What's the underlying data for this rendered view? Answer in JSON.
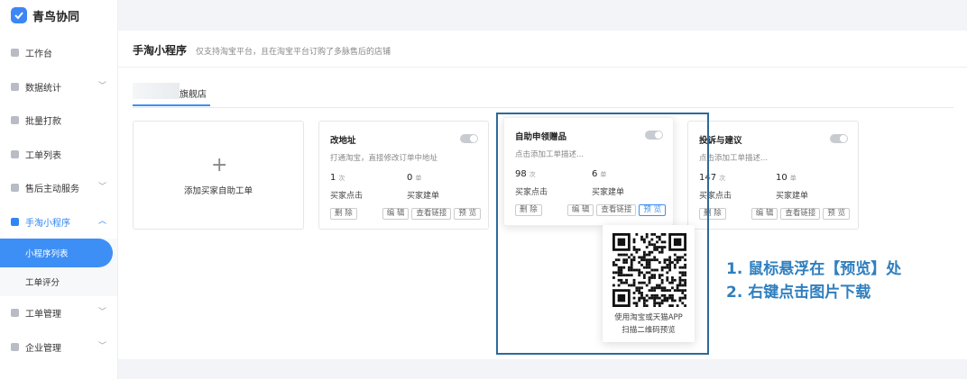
{
  "app": {
    "name": "青鸟协同"
  },
  "sidebar": {
    "items": [
      {
        "label": "工作台",
        "icon": "desktop-icon"
      },
      {
        "label": "数据统计",
        "icon": "bar-chart-icon",
        "expandable": true
      },
      {
        "label": "批量打款",
        "icon": "coin-icon"
      },
      {
        "label": "工单列表",
        "icon": "search-icon"
      },
      {
        "label": "售后主动服务",
        "icon": "message-icon",
        "expandable": true
      },
      {
        "label": "手淘小程序",
        "icon": "folder-icon",
        "expandable": true,
        "active": true
      }
    ],
    "sub_items": [
      {
        "label": "小程序列表",
        "active": true
      },
      {
        "label": "工单评分"
      }
    ],
    "items_after": [
      {
        "label": "工单管理",
        "icon": "list-icon",
        "expandable": true
      },
      {
        "label": "企业管理",
        "icon": "building-icon",
        "expandable": true
      }
    ]
  },
  "page": {
    "title": "手淘小程序",
    "description": "仅支持淘宝平台，且在淘宝平台订购了多脉售后的店铺",
    "shop_tab": "旗舰店"
  },
  "add_card": {
    "label": "添加买家自助工单"
  },
  "cards": [
    {
      "title": "改地址",
      "description": "打通淘宝，直接修改订单中地址",
      "clicks": "1",
      "click_unit": "次",
      "click_label": "买家点击",
      "orders": "0",
      "order_unit": "单",
      "order_label": "买家建单",
      "buttons": {
        "delete": "删 除",
        "edit": "编 辑",
        "link": "查看链接",
        "preview": "预 览"
      }
    },
    {
      "title": "自助申领赠品",
      "description": "点击添加工单描述...",
      "clicks": "98",
      "click_unit": "次",
      "click_label": "买家点击",
      "orders": "6",
      "order_unit": "单",
      "order_label": "买家建单",
      "buttons": {
        "delete": "删 除",
        "edit": "编 辑",
        "link": "查看链接",
        "preview": "预 览"
      }
    },
    {
      "title": "投诉与建议",
      "description": "点击添加工单描述...",
      "clicks": "147",
      "click_unit": "次",
      "click_label": "买家点击",
      "orders": "10",
      "order_unit": "单",
      "order_label": "买家建单",
      "buttons": {
        "delete": "删 除",
        "edit": "编 辑",
        "link": "查看链接",
        "preview": "预 览"
      }
    }
  ],
  "qr_popup": {
    "caption_line1": "使用淘宝或天猫APP",
    "caption_line2": "扫描二维码预览"
  },
  "annotations": {
    "step1": "1. 鼠标悬浮在【预览】处",
    "step2": "2. 右键点击图片下载"
  },
  "colors": {
    "accent": "#3d8ff5",
    "annotation": "#2f7fbf",
    "highlight_frame": "#2c6a9a"
  }
}
